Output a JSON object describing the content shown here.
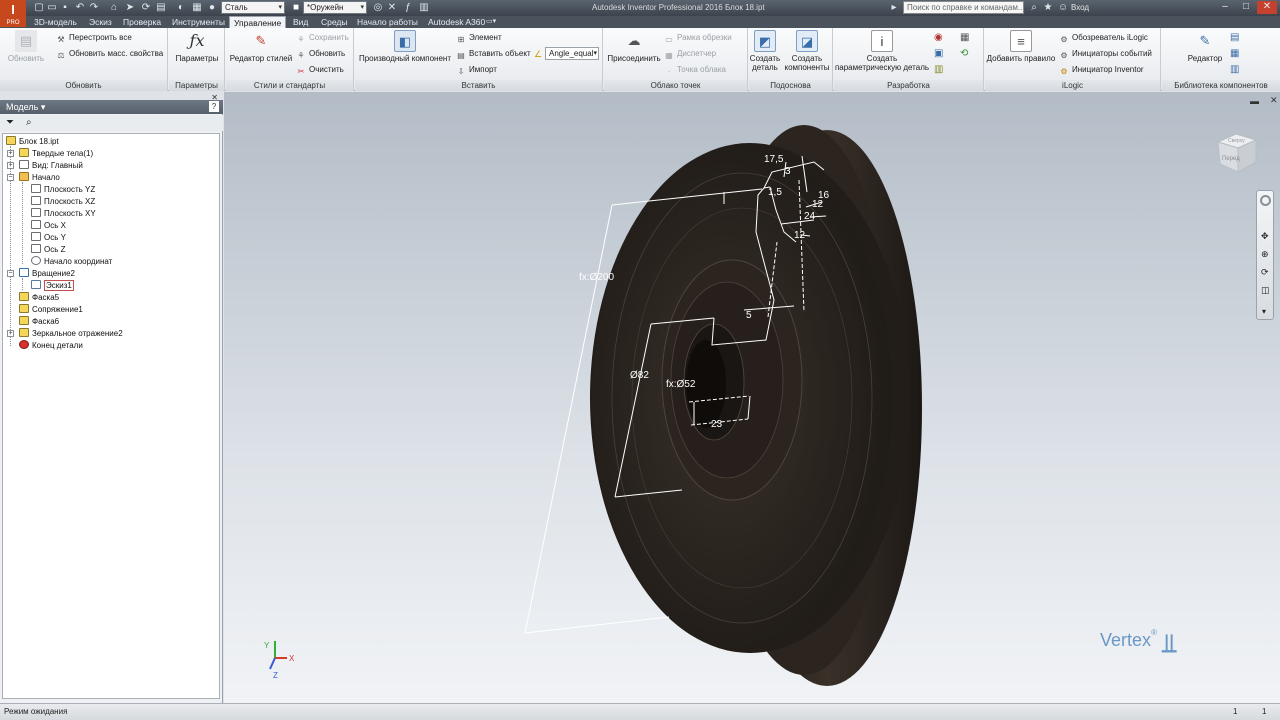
{
  "app": {
    "logo": "I",
    "logo_sub": "PRO",
    "window_title": "Autodesk Inventor Professional 2016   Блок 18.ipt",
    "help_search_placeholder": "Поиск по справке и командам...",
    "signin": "Вход"
  },
  "quick_access": {
    "material": "Сталь",
    "appearance": "*Оружейн"
  },
  "tabs": [
    "3D-модель",
    "Эскиз",
    "Проверка",
    "Инструменты",
    "Управление",
    "Вид",
    "Среды",
    "Начало работы",
    "Autodesk A360"
  ],
  "active_tab": "Управление",
  "ribbon": {
    "update": {
      "title": "Обновить",
      "update_btn": "Обновить",
      "rebuild_all": "Перестроить все",
      "update_mass": "Обновить масс. свойства"
    },
    "params": {
      "title": "Параметры",
      "params_btn": "Параметры"
    },
    "styles": {
      "title": "Стили и стандарты",
      "editor": "Редактор стилей",
      "save": "Сохранить",
      "update": "Обновить",
      "purge": "Очистить"
    },
    "insert": {
      "title": "Вставить",
      "derive": "Производный компонент",
      "element": "Элемент",
      "insert_object": "Вставить объект",
      "import": "Импорт",
      "combo": "Angle_equal"
    },
    "pointcloud": {
      "title": "Облако точек",
      "attach": "Присоединить",
      "crop_frame": "Рамка обрезки",
      "manager": "Диспетчер",
      "cloud_point": "Точка облака"
    },
    "layout": {
      "title": "Подоснова",
      "make_part": "Создать деталь",
      "make_components": "Создать компоненты"
    },
    "author": {
      "title": "Разработка",
      "create_ipart": "Создать параметрическую деталь"
    },
    "ilogic": {
      "title": "iLogic",
      "add_rule": "Добавить правило",
      "browser": "Обозреватель iLogic",
      "event_triggers": "Инициаторы событий",
      "trigger_inventor": "Инициатор Inventor"
    },
    "content": {
      "title": "Библиотека компонентов",
      "editor": "Редактор"
    }
  },
  "browser": {
    "title": "Модель",
    "tree": [
      {
        "label": "Блок 18.ipt",
        "icon": "part-icon"
      },
      {
        "label": "Твердые тела(1)",
        "icon": "solid-bodies-icon"
      },
      {
        "label": "Вид: Главный",
        "icon": "view-icon"
      },
      {
        "label": "Начало",
        "icon": "origin-folder-icon"
      },
      {
        "label": "Плоскость YZ",
        "icon": "plane-icon"
      },
      {
        "label": "Плоскость XZ",
        "icon": "plane-icon"
      },
      {
        "label": "Плоскость XY",
        "icon": "plane-icon"
      },
      {
        "label": "Ось X",
        "icon": "axis-icon"
      },
      {
        "label": "Ось Y",
        "icon": "axis-icon"
      },
      {
        "label": "Ось Z",
        "icon": "axis-icon"
      },
      {
        "label": "Начало координат",
        "icon": "center-point-icon"
      },
      {
        "label": "Вращение2",
        "icon": "revolve-icon"
      },
      {
        "label": "Эскиз1",
        "icon": "sketch-icon"
      },
      {
        "label": "Фаска5",
        "icon": "chamfer-icon"
      },
      {
        "label": "Сопряжение1",
        "icon": "fillet-icon"
      },
      {
        "label": "Фаска6",
        "icon": "chamfer-icon"
      },
      {
        "label": "Зеркальное отражение2",
        "icon": "mirror-icon"
      },
      {
        "label": "Конец детали",
        "icon": "end-of-part-icon"
      }
    ]
  },
  "dimensions": {
    "d1": "17,5",
    "d2": "3",
    "d3": "1,5",
    "d4": "16",
    "d5": "12",
    "d6": "24",
    "d7": "12",
    "d8": "fx:Ø200",
    "d9": "5",
    "d10": "Ø82",
    "d11": "fx:Ø52",
    "d12": "23"
  },
  "viewcube": {
    "face_top": "Сверху",
    "face_front": "Перед"
  },
  "triad": {
    "x": "X",
    "y": "Y",
    "z": "Z"
  },
  "watermark": "Vertex",
  "status": {
    "text": "Режим ожидания",
    "count1": "1",
    "count2": "1"
  },
  "colors": {
    "accent": "#c8481e",
    "part_body": "#2e2620",
    "tab_bar": "#4a525c"
  }
}
